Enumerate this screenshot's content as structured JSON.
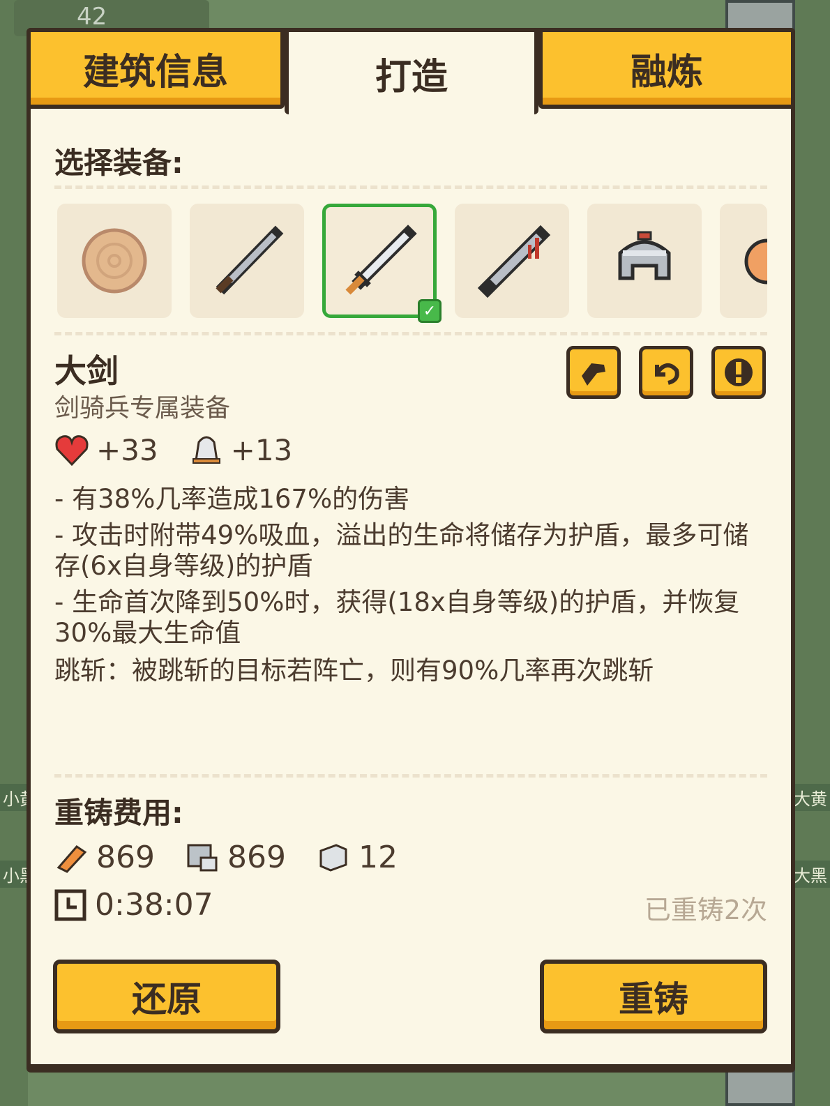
{
  "background": {
    "level_number": "42",
    "left_labels": [
      "小黄",
      "小黑"
    ],
    "right_labels": [
      "大黄",
      "大黑"
    ]
  },
  "tabs": [
    {
      "label": "建筑信息",
      "active": false
    },
    {
      "label": "打造",
      "active": true
    },
    {
      "label": "融炼",
      "active": false
    }
  ],
  "select_title": "选择装备:",
  "equipment_slots": [
    {
      "icon": "wooden-shield-icon",
      "selected": false
    },
    {
      "icon": "sword-icon",
      "selected": false
    },
    {
      "icon": "greatsword-icon",
      "selected": true
    },
    {
      "icon": "bloody-sword-icon",
      "selected": false
    },
    {
      "icon": "helmet-icon",
      "selected": false
    },
    {
      "icon": "orange-item-icon",
      "selected": false
    }
  ],
  "item": {
    "name": "大剑",
    "subtitle": "剑骑兵专属装备",
    "stats": [
      {
        "icon": "heart-icon",
        "value": "+33"
      },
      {
        "icon": "bell-icon",
        "value": "+13"
      }
    ],
    "effects": [
      "- 有38%几率造成167%的伤害",
      "- 攻击时附带49%吸血，溢出的生命将储存为护盾，最多可储存(6x自身等级)的护盾",
      "- 生命首次降到50%时，获得(18x自身等级)的护盾，并恢复30%最大生命值",
      "跳斩：被跳斩的目标若阵亡，则有90%几率再次跳斩"
    ]
  },
  "action_icons": [
    "hammer-icon",
    "undo-icon",
    "upgrade-icon"
  ],
  "cost_title": "重铸费用:",
  "costs": [
    {
      "icon": "wood-icon",
      "value": "869"
    },
    {
      "icon": "stone-icon",
      "value": "869"
    },
    {
      "icon": "iron-icon",
      "value": "12"
    }
  ],
  "timer": "0:38:07",
  "reforge_count": "已重铸2次",
  "buttons": {
    "restore": "还原",
    "reforge": "重铸"
  },
  "colors": {
    "accent": "#fcc12e",
    "panel": "#fbf7e6",
    "border": "#3b2d22",
    "selected": "#36a83a"
  }
}
